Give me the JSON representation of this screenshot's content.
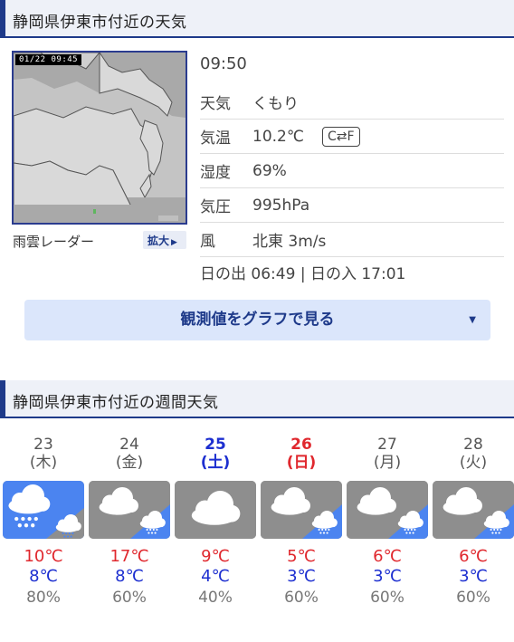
{
  "current": {
    "section_title": "静岡県伊東市付近の天気",
    "radar_timestamp": "01/22 09:45",
    "radar_label": "雨雲レーダー",
    "zoom_label": "拡大",
    "time": "09:50",
    "rows": [
      {
        "key": "天気",
        "value": "くもり"
      },
      {
        "key": "気温",
        "value": "10.2℃"
      },
      {
        "key": "湿度",
        "value": "69%"
      },
      {
        "key": "気圧",
        "value": "995hPa"
      },
      {
        "key": "風",
        "value": "北東 3m/s"
      }
    ],
    "unit_toggle": "C⇄F",
    "sunrise_label": "日の出",
    "sunrise": "06:49",
    "sunset_label": "日の入",
    "sunset": "17:01",
    "graph_button": "観測値をグラフで見る"
  },
  "weekly": {
    "section_title": "静岡県伊東市付近の週間天気",
    "days": [
      {
        "date": "23",
        "dow": "(木)",
        "icon": "rain-then-cloudy-rain-icon",
        "high": "10℃",
        "low": "8℃",
        "pop": "80%"
      },
      {
        "date": "24",
        "dow": "(金)",
        "icon": "cloudy-then-rain-icon",
        "high": "17℃",
        "low": "8℃",
        "pop": "60%"
      },
      {
        "date": "25",
        "dow": "(土)",
        "icon": "cloudy-icon",
        "high": "9℃",
        "low": "4℃",
        "pop": "40%"
      },
      {
        "date": "26",
        "dow": "(日)",
        "icon": "cloudy-then-rain-icon",
        "high": "5℃",
        "low": "3℃",
        "pop": "60%"
      },
      {
        "date": "27",
        "dow": "(月)",
        "icon": "cloudy-then-rain-icon",
        "high": "6℃",
        "low": "3℃",
        "pop": "60%"
      },
      {
        "date": "28",
        "dow": "(火)",
        "icon": "cloudy-then-rain-icon",
        "high": "6℃",
        "low": "3℃",
        "pop": "60%"
      }
    ]
  },
  "colors": {
    "accent": "#1e3a8a",
    "rain_bg": "#4b84f0",
    "cloud_bg": "#8e8e8e",
    "high_temp": "#e0282e",
    "low_temp": "#1d2fd0"
  }
}
